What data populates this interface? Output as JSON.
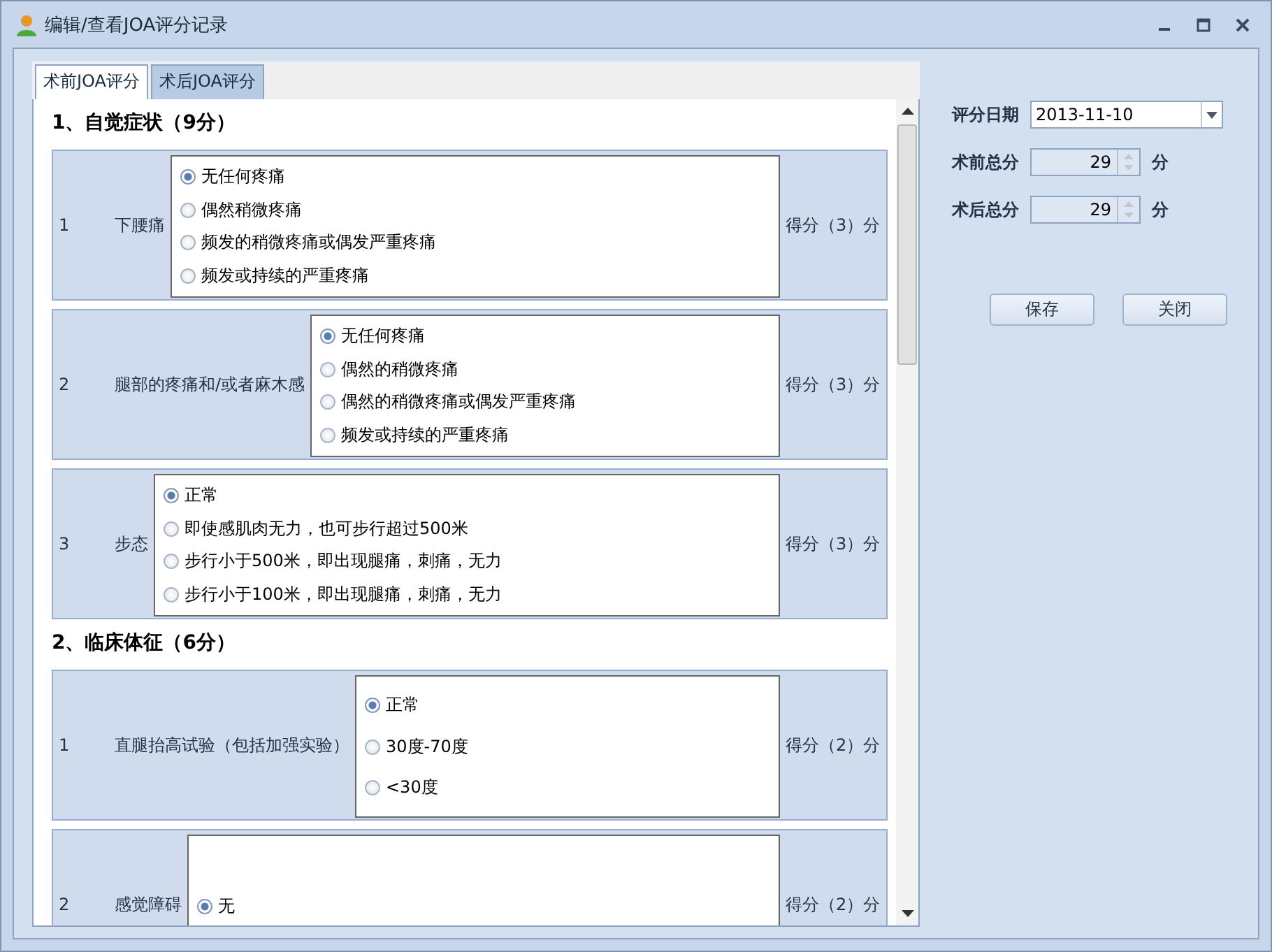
{
  "window": {
    "title": "编辑/查看JOA评分记录"
  },
  "tabs": [
    {
      "label": "术前JOA评分",
      "selected": true
    },
    {
      "label": "术后JOA评分",
      "selected": false
    }
  ],
  "sections": [
    {
      "heading": "1、自觉症状（9分）",
      "items": [
        {
          "number": "1",
          "label": "下腰痛",
          "score": "得分（3）分",
          "options": [
            {
              "text": "无任何疼痛",
              "selected": true
            },
            {
              "text": "偶然稍微疼痛",
              "selected": false
            },
            {
              "text": "频发的稍微疼痛或偶发严重疼痛",
              "selected": false
            },
            {
              "text": "频发或持续的严重疼痛",
              "selected": false
            }
          ]
        },
        {
          "number": "2",
          "label": "腿部的疼痛和/或者麻木感",
          "score": "得分（3）分",
          "options": [
            {
              "text": "无任何疼痛",
              "selected": true
            },
            {
              "text": "偶然的稍微疼痛",
              "selected": false
            },
            {
              "text": "偶然的稍微疼痛或偶发严重疼痛",
              "selected": false
            },
            {
              "text": "频发或持续的严重疼痛",
              "selected": false
            }
          ]
        },
        {
          "number": "3",
          "label": "步态",
          "score": "得分（3）分",
          "options": [
            {
              "text": "正常",
              "selected": true
            },
            {
              "text": "即使感肌肉无力，也可步行超过500米",
              "selected": false
            },
            {
              "text": "步行小于500米，即出现腿痛，刺痛，无力",
              "selected": false
            },
            {
              "text": "步行小于100米，即出现腿痛，刺痛，无力",
              "selected": false
            }
          ]
        }
      ]
    },
    {
      "heading": "2、临床体征（6分）",
      "items": [
        {
          "number": "1",
          "label": "直腿抬高试验（包括加强实验）",
          "score": "得分（2）分",
          "options": [
            {
              "text": "正常",
              "selected": true
            },
            {
              "text": "30度-70度",
              "selected": false
            },
            {
              "text": "<30度",
              "selected": false
            }
          ]
        },
        {
          "number": "2",
          "label": "感觉障碍",
          "score": "得分（2）分",
          "options": [
            {
              "text": "无",
              "selected": true
            }
          ]
        }
      ]
    }
  ],
  "summary": {
    "date_label": "评分日期",
    "date": "2013-11-10",
    "pre_label": "术前总分",
    "pre_value": "29",
    "pre_unit": "分",
    "post_label": "术后总分",
    "post_value": "29",
    "post_unit": "分"
  },
  "buttons": [
    "保存",
    "关闭"
  ]
}
